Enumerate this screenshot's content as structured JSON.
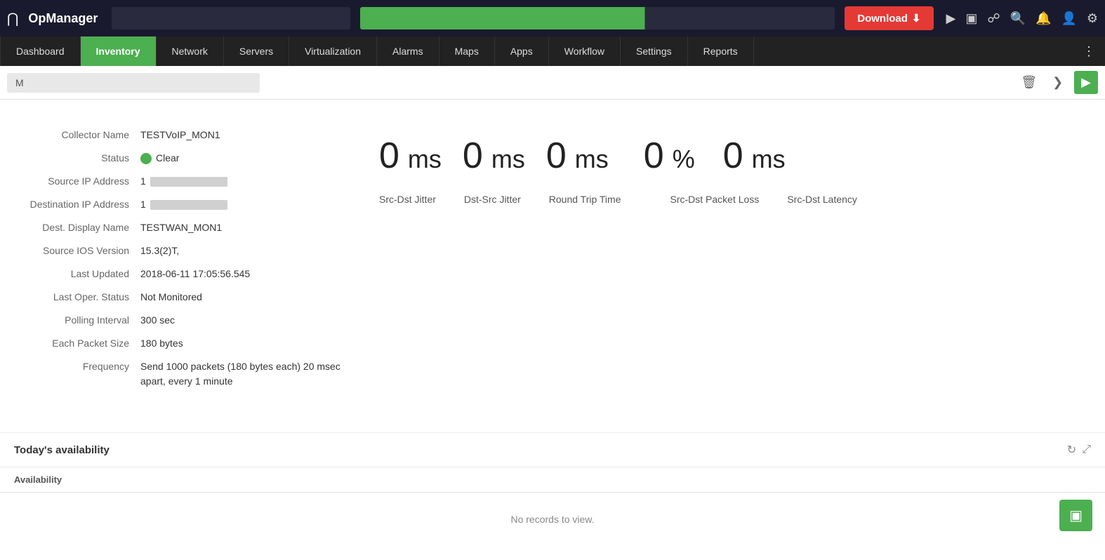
{
  "app": {
    "grid_icon": "⊞",
    "name": "OpManager"
  },
  "top_bar": {
    "search_placeholder": "",
    "download_label": "Download",
    "icons": [
      "rocket",
      "monitor",
      "bell-o",
      "search",
      "bell",
      "user",
      "gear"
    ]
  },
  "nav": {
    "items": [
      {
        "label": "Dashboard",
        "active": false
      },
      {
        "label": "Inventory",
        "active": true
      },
      {
        "label": "Network",
        "active": false
      },
      {
        "label": "Servers",
        "active": false
      },
      {
        "label": "Virtualization",
        "active": false
      },
      {
        "label": "Alarms",
        "active": false
      },
      {
        "label": "Maps",
        "active": false
      },
      {
        "label": "Apps",
        "active": false
      },
      {
        "label": "Workflow",
        "active": false
      },
      {
        "label": "Settings",
        "active": false
      },
      {
        "label": "Reports",
        "active": false
      }
    ],
    "more": "⋮"
  },
  "page_header": {
    "breadcrumb": "M",
    "delete_icon": "🗑",
    "chevron_right": "›"
  },
  "detail": {
    "fields": [
      {
        "label": "Collector Name",
        "value": "TESTVoIP_MON1",
        "type": "text"
      },
      {
        "label": "Status",
        "value": "Clear",
        "type": "status"
      },
      {
        "label": "Source IP Address",
        "value": "1",
        "type": "redacted"
      },
      {
        "label": "Destination IP Address",
        "value": "1",
        "type": "redacted"
      },
      {
        "label": "Dest. Display Name",
        "value": "TESTWAN_MON1",
        "type": "text"
      },
      {
        "label": "Source IOS Version",
        "value": "15.3(2)T,",
        "type": "text"
      },
      {
        "label": "Last Updated",
        "value": "2018-06-11 17:05:56.545",
        "type": "text"
      },
      {
        "label": "Last Oper. Status",
        "value": "Not Monitored",
        "type": "text"
      },
      {
        "label": "Polling Interval",
        "value": "300 sec",
        "type": "text"
      },
      {
        "label": "Each Packet Size",
        "value": "180 bytes",
        "type": "text"
      },
      {
        "label": "Frequency",
        "value": "Send 1000 packets (180 bytes each) 20 msec apart, every 1 minute",
        "type": "text"
      }
    ]
  },
  "metrics": {
    "values": [
      {
        "value": "0",
        "unit": "ms"
      },
      {
        "value": "0",
        "unit": "ms"
      },
      {
        "value": "0",
        "unit": "ms"
      },
      {
        "value": "0",
        "unit": "%"
      },
      {
        "value": "0",
        "unit": "ms"
      }
    ],
    "labels": [
      "Src-Dst Jitter",
      "Dst-Src Jitter",
      "Round Trip Time",
      "Src-Dst Packet Loss",
      "Src-Dst Latency"
    ]
  },
  "availability": {
    "title": "Today's availability",
    "column": "Availability",
    "no_records": "No records to view.",
    "refresh_icon": "↻",
    "expand_icon": "⤢"
  }
}
